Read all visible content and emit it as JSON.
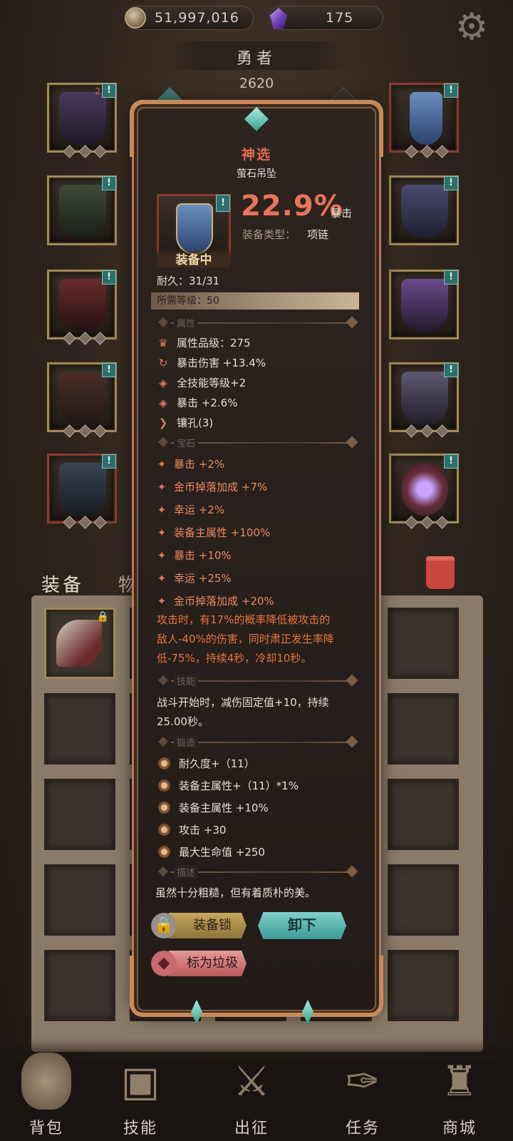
{
  "top_bar": {
    "gold": "51,997,016",
    "gems": "175",
    "icons": [
      "coin-icon",
      "purple-gem-icon",
      "gear-icon"
    ]
  },
  "hero": {
    "name": "勇者",
    "power": "2620"
  },
  "equipment_slots": {
    "left": [
      {
        "tag": "!",
        "badge": "2"
      },
      {
        "tag": "!"
      },
      {
        "tag": "!"
      },
      {
        "tag": "!"
      },
      {
        "tag": "!"
      }
    ],
    "right": [
      {
        "tag": "!"
      },
      {
        "tag": "!"
      },
      {
        "tag": "!"
      },
      {
        "tag": "!"
      },
      {
        "tag": "!"
      }
    ]
  },
  "bag_tabs": {
    "equipment": "装备",
    "items": "物品"
  },
  "tooltip": {
    "rarity": "神选",
    "item_name": "萤石吊坠",
    "icon_tag": "!",
    "equipped_label": "装备中",
    "main_value": "22.9%",
    "main_stat": "暴击",
    "type_label": "装备类型：",
    "type_value": "项链",
    "durability": "耐久：31/31",
    "required_level": "所需等级：50",
    "section_attributes": "属性",
    "attributes": [
      {
        "icon": "quality-icon",
        "text": "属性品级：275"
      },
      {
        "icon": "crit-damage-icon",
        "text": "暴击伤害 +13.4%"
      },
      {
        "icon": "skill-icon",
        "text": "全技能等级+2"
      },
      {
        "icon": "crit-icon",
        "text": "暴击 +2.6%"
      },
      {
        "icon": "socket-icon",
        "text": "镶孔(3)"
      }
    ],
    "section_gems": "宝石",
    "gems": [
      "暴击 +2%",
      "金币掉落加成 +7%",
      "幸运 +2%",
      "装备主属性 +100%",
      "暴击 +10%",
      "幸运 +25%",
      "金币掉落加成 +20%"
    ],
    "gem_effect_lines": [
      "攻击时，有17%的概率降低被攻击的",
      "敌人-40%的伤害，同时肃正发生率降",
      "低-75%，持续4秒，冷却10秒。"
    ],
    "section_skill": "技能",
    "skill_lines": [
      "战斗开始时，减伤固定值+10，持续",
      "25.00秒。"
    ],
    "section_forge": "锻造",
    "forge": [
      "耐久度+（11）",
      "装备主属性+（11）*1%",
      "装备主属性 +10%",
      "攻击 +30",
      "最大生命值 +250"
    ],
    "section_description": "描述",
    "description": "虽然十分粗糙，但有着质朴的美。",
    "buttons": {
      "lock": "装备锁",
      "unequip": "卸下",
      "mark_junk": "标为垃圾"
    }
  },
  "bottom_nav": [
    {
      "label": "背包",
      "icon": "backpack-icon"
    },
    {
      "label": "技能",
      "icon": "skill-book-icon"
    },
    {
      "label": "出征",
      "icon": "expedition-icon"
    },
    {
      "label": "任务",
      "icon": "quest-scroll-icon"
    },
    {
      "label": "商城",
      "icon": "shop-icon"
    }
  ]
}
